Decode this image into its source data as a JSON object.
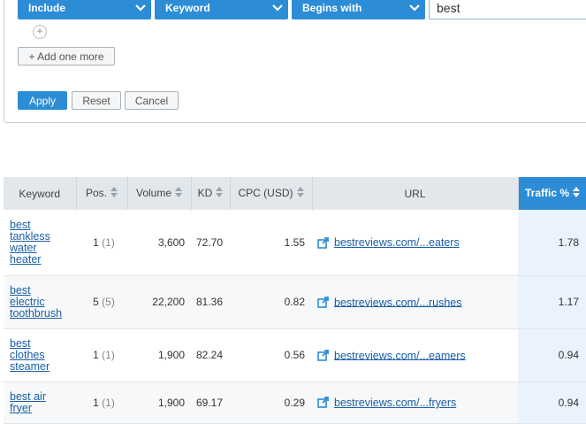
{
  "filter": {
    "include_label": "Include",
    "field_label": "Keyword",
    "condition_label": "Begins with",
    "value": "best",
    "add_more_label": "+ Add one more",
    "apply_label": "Apply",
    "reset_label": "Reset",
    "cancel_label": "Cancel"
  },
  "table": {
    "headers": {
      "keyword": "Keyword",
      "pos": "Pos.",
      "volume": "Volume",
      "kd": "KD",
      "cpc": "CPC (USD)",
      "url": "URL",
      "traffic": "Traffic %"
    },
    "rows": [
      {
        "keyword": "best tankless water heater",
        "pos": "1",
        "pos_prev": "(1)",
        "volume": "3,600",
        "kd": "72.70",
        "cpc": "1.55",
        "url": "bestreviews.com/...eaters",
        "traffic": "1.78"
      },
      {
        "keyword": "best electric toothbrush",
        "pos": "5",
        "pos_prev": "(5)",
        "volume": "22,200",
        "kd": "81.36",
        "cpc": "0.82",
        "url": "bestreviews.com/...rushes",
        "traffic": "1.17"
      },
      {
        "keyword": "best clothes steamer",
        "pos": "1",
        "pos_prev": "(1)",
        "volume": "1,900",
        "kd": "82.24",
        "cpc": "0.56",
        "url": "bestreviews.com/...eamers",
        "traffic": "0.94"
      },
      {
        "keyword": "best air fryer",
        "pos": "1",
        "pos_prev": "(1)",
        "volume": "1,900",
        "kd": "69.17",
        "cpc": "0.29",
        "url": "bestreviews.com/...fryers",
        "traffic": "0.94"
      }
    ]
  },
  "icons": {
    "dropdown": "chevron-down-icon",
    "add": "plus-icon",
    "sort": "sort-arrows-icon",
    "external": "external-link-icon"
  },
  "colors": {
    "accent": "#2c8dd6",
    "link": "#1a5fa6",
    "header_bg": "#e2e7eb",
    "traffic_col_bg": "#eaf3fb"
  }
}
